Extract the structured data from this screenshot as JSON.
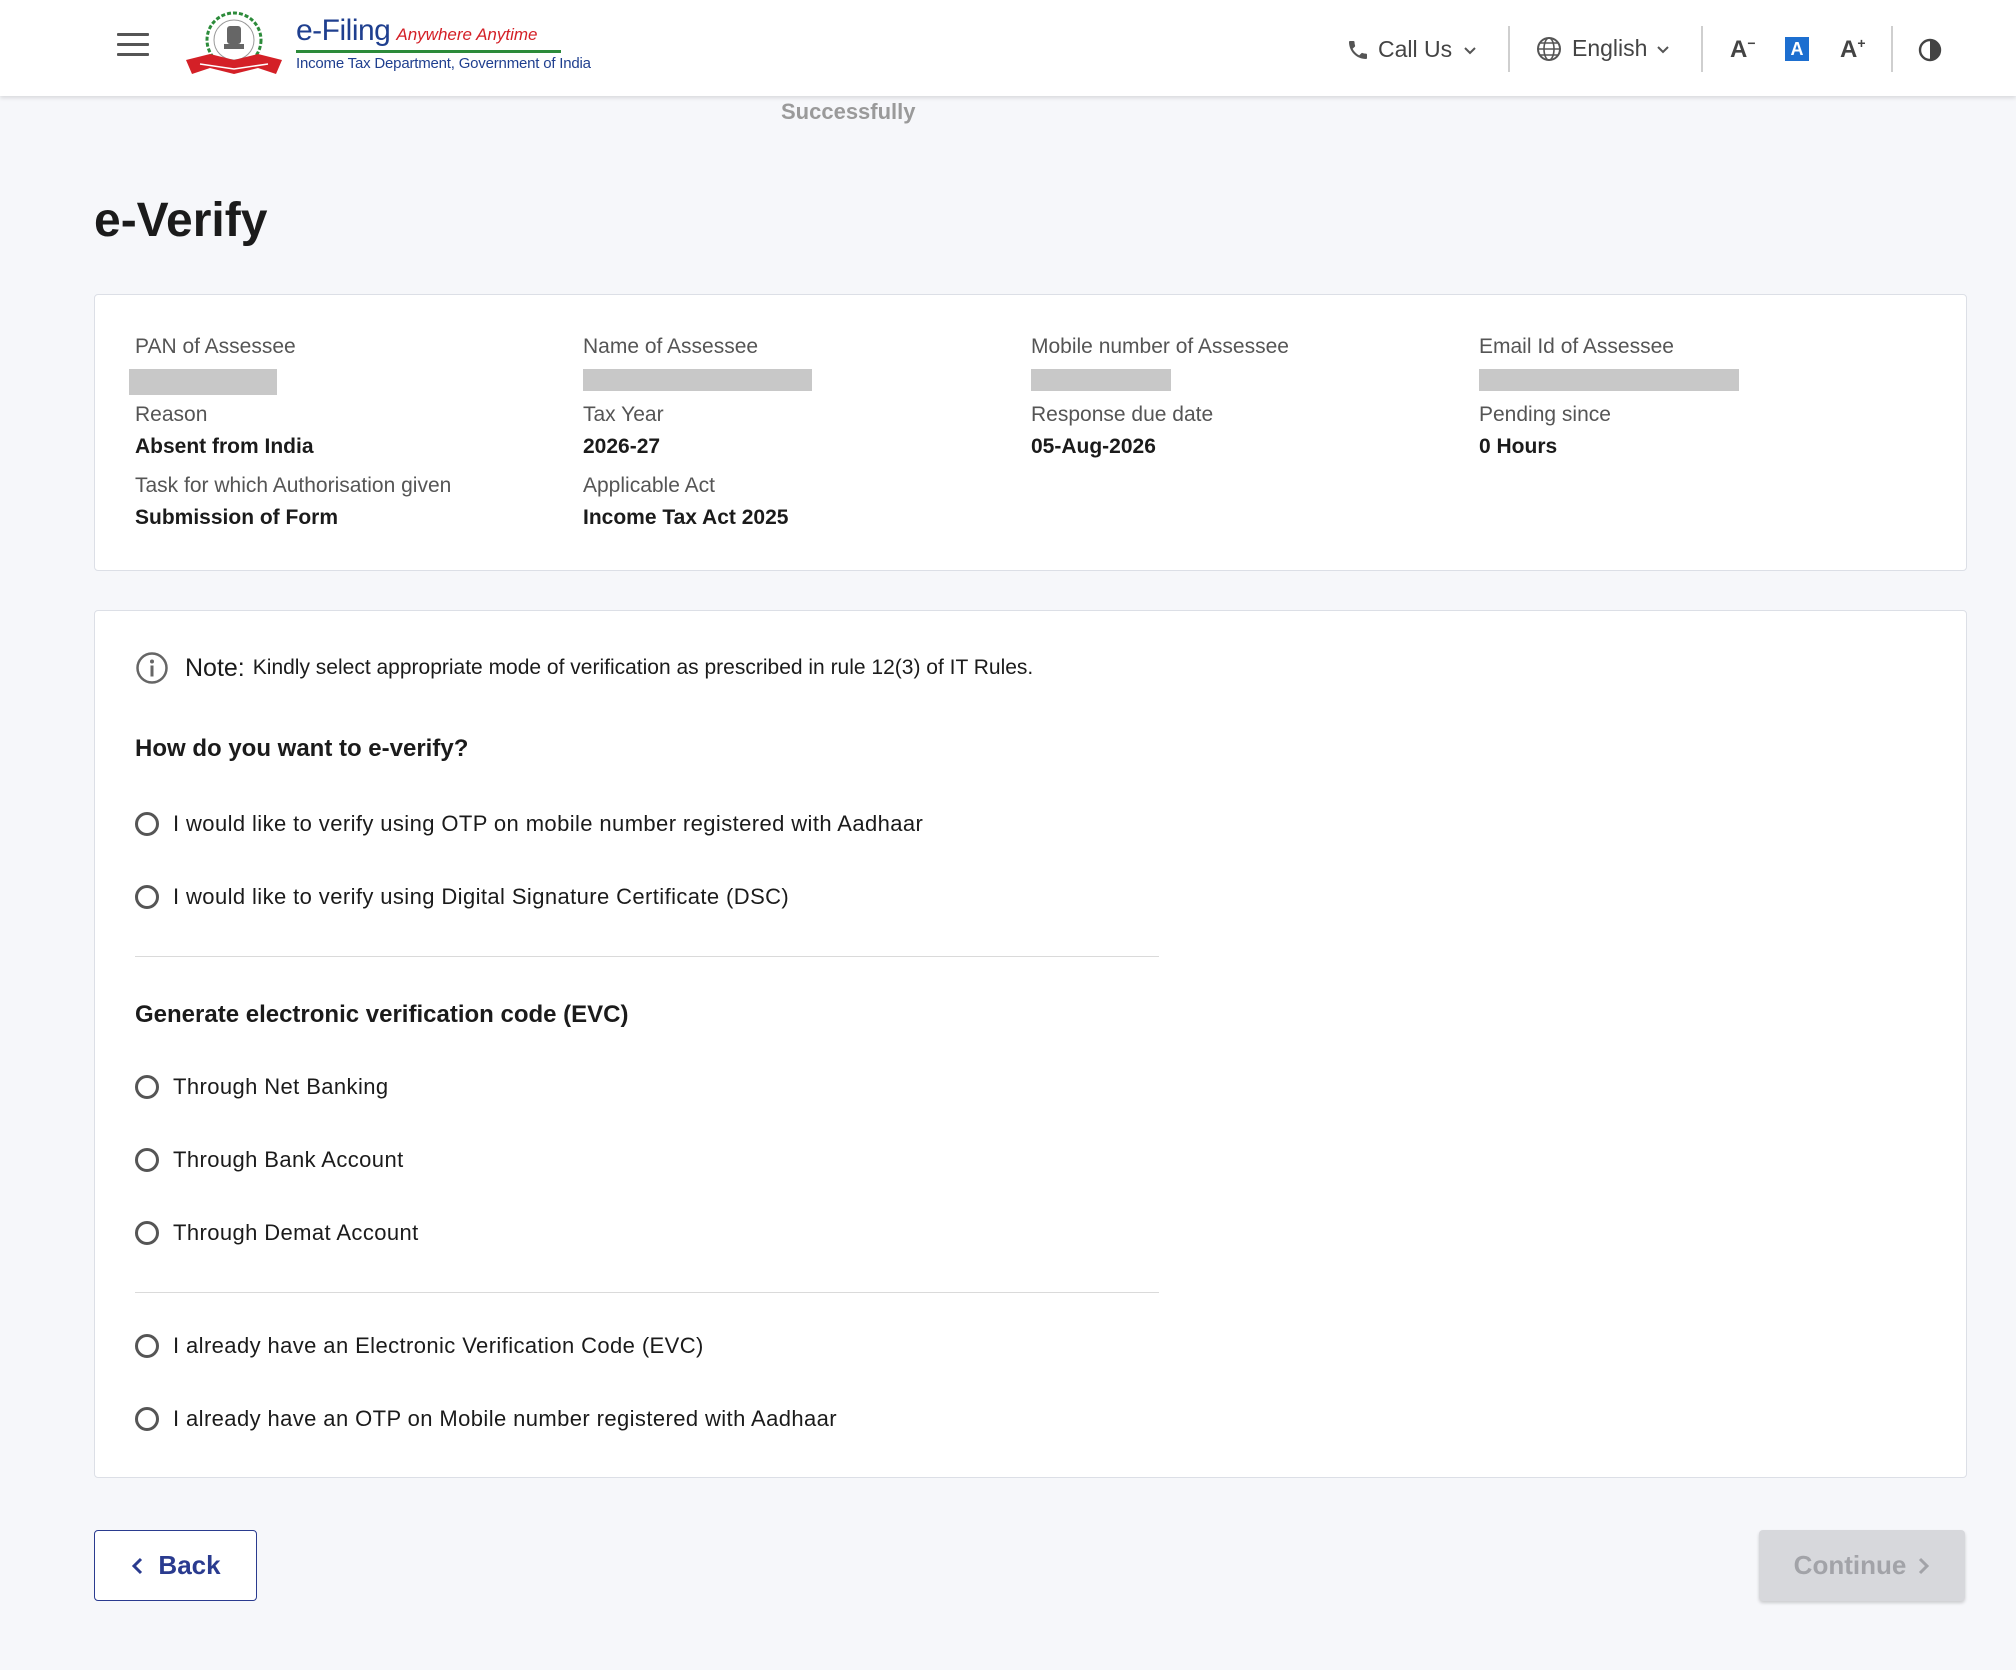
{
  "header": {
    "logo_title": "e-Filing",
    "logo_tagline": "Anywhere Anytime",
    "logo_subtitle": "Income Tax Department, Government of India",
    "call_us": "Call Us",
    "language": "English",
    "font_decrease": "A",
    "font_default": "A",
    "font_increase": "A",
    "accent_color": "#1d6fd0"
  },
  "banner_text": "Successfully",
  "page_title": "e-Verify",
  "info": {
    "pan_label": "PAN of Assessee",
    "name_label": "Name of Assessee",
    "mobile_label": "Mobile number of Assessee",
    "email_label": "Email Id of Assessee",
    "reason_label": "Reason",
    "reason_value": "Absent from India",
    "tax_year_label": "Tax Year",
    "tax_year_value": "2026-27",
    "due_date_label": "Response due date",
    "due_date_value": "05-Aug-2026",
    "pending_label": "Pending since",
    "pending_value": "0 Hours",
    "task_label": "Task for which Authorisation given",
    "task_value": "Submission of Form",
    "act_label": "Applicable Act",
    "act_value": "Income Tax Act 2025"
  },
  "note": {
    "label": "Note:",
    "text": "Kindly select appropriate mode of verification as prescribed in rule 12(3) of IT Rules."
  },
  "sections": {
    "everify_title": "How do you want to e-verify?",
    "evc_title": "Generate electronic verification code (EVC)"
  },
  "options": {
    "otp_aadhaar": "I would like to verify using OTP on mobile number registered with Aadhaar",
    "dsc": "I would like to verify using Digital Signature Certificate (DSC)",
    "net_banking": "Through Net Banking",
    "bank_account": "Through Bank Account",
    "demat_account": "Through Demat Account",
    "have_evc": "I already have an Electronic Verification Code (EVC)",
    "have_otp": "I already have an OTP on Mobile number registered with Aadhaar"
  },
  "buttons": {
    "back": "Back",
    "continue": "Continue",
    "back_color": "#2a3b8f"
  }
}
